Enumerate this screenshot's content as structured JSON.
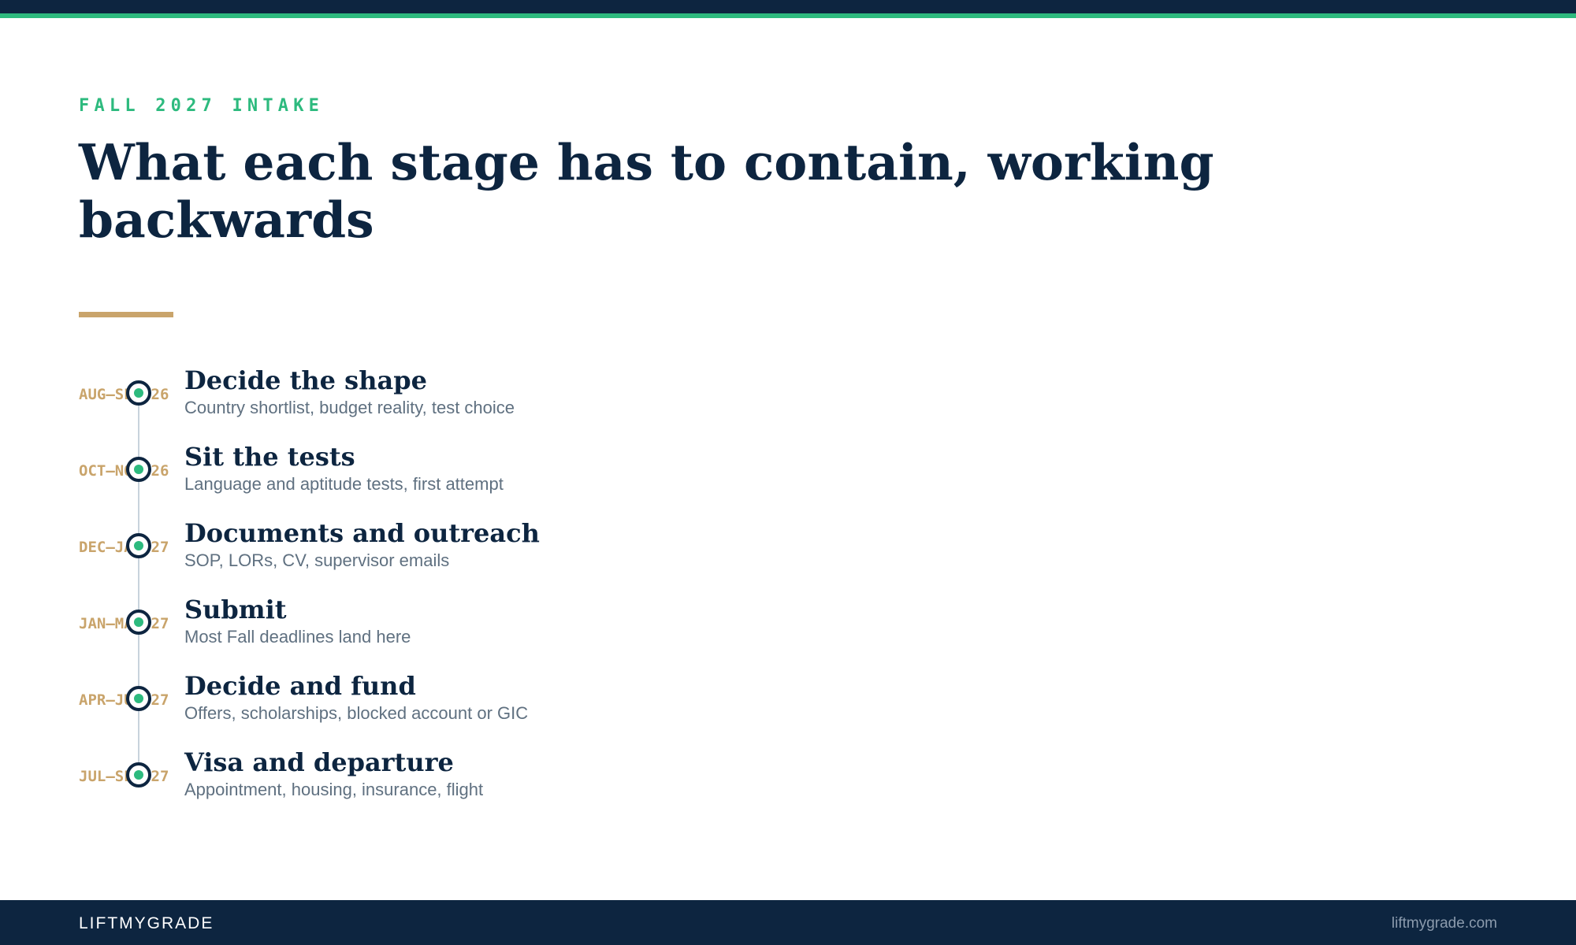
{
  "header": {
    "eyebrow": "FALL 2027 INTAKE",
    "title": "What each stage has to contain, working backwards"
  },
  "colors": {
    "navy": "#0d2540",
    "green": "#2dba7e",
    "gold": "#c9a46b",
    "muted": "#5f7080"
  },
  "stages": [
    {
      "range": "AUG–SEP 26",
      "title": "Decide the shape",
      "desc": "Country shortlist, budget reality, test choice"
    },
    {
      "range": "OCT–NOV 26",
      "title": "Sit the tests",
      "desc": "Language and aptitude tests, first attempt"
    },
    {
      "range": "DEC–JAN 27",
      "title": "Documents and outreach",
      "desc": "SOP, LORs, CV, supervisor emails"
    },
    {
      "range": "JAN–MAR 27",
      "title": "Submit",
      "desc": "Most Fall deadlines land here"
    },
    {
      "range": "APR–JUN 27",
      "title": "Decide and fund",
      "desc": "Offers, scholarships, blocked account or GIC"
    },
    {
      "range": "JUL–SEP 27",
      "title": "Visa and departure",
      "desc": "Appointment, housing, insurance, flight"
    }
  ],
  "footer": {
    "brand": "LIFTMYGRADE",
    "site": "liftmygrade.com"
  }
}
